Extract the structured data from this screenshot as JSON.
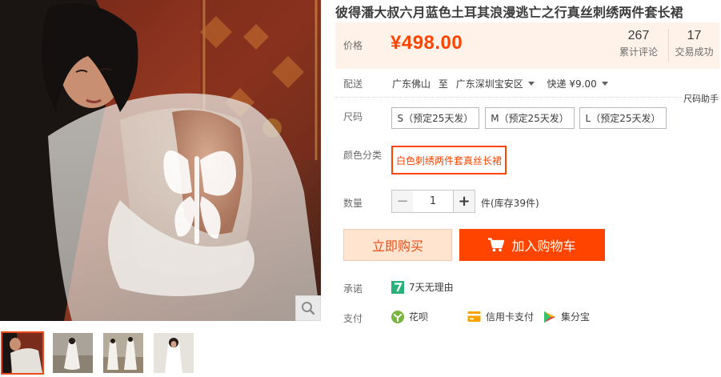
{
  "product": {
    "title": "彼得潘大叔六月蓝色土耳其浪漫逃亡之行真丝刺绣两件套长裙"
  },
  "price": {
    "label": "价格",
    "value": "¥498.00"
  },
  "stats": {
    "reviews_count": "267",
    "reviews_label": "累计评论",
    "deals_count": "17",
    "deals_label": "交易成功"
  },
  "shipping": {
    "label": "配送",
    "from": "广东佛山",
    "to_word": "至",
    "to": "广东深圳宝安区",
    "method": "快递 ¥9.00"
  },
  "size_helper": "尺码助手",
  "size": {
    "label": "尺码",
    "options": [
      "S（预定25天发）",
      "M（预定25天发）",
      "L（预定25天发）"
    ]
  },
  "color": {
    "label": "颜色分类",
    "options": [
      "白色刺绣两件套真丝长裙"
    ]
  },
  "quantity": {
    "label": "数量",
    "minus": "−",
    "value": "1",
    "plus": "+",
    "stock": "件(库存39件)"
  },
  "actions": {
    "buy_now": "立即购买",
    "add_cart": "加入购物车"
  },
  "promise": {
    "label": "承诺",
    "item": "7天无理由"
  },
  "payment": {
    "label": "支付",
    "methods": [
      "花呗",
      "信用卡支付",
      "集分宝"
    ]
  },
  "colors": {
    "accent": "#ff4400",
    "price": "#ff4400",
    "price_bg": "#fff2e8",
    "buy_now_bg": "#ffe4d0"
  },
  "icons": {
    "zoom": "magnifier-icon",
    "cart": "shopping-cart-icon",
    "promise": "seven-days-icon",
    "huabei": "huabei-icon",
    "credit": "credit-card-icon",
    "jifenbao": "jifenbao-icon"
  }
}
